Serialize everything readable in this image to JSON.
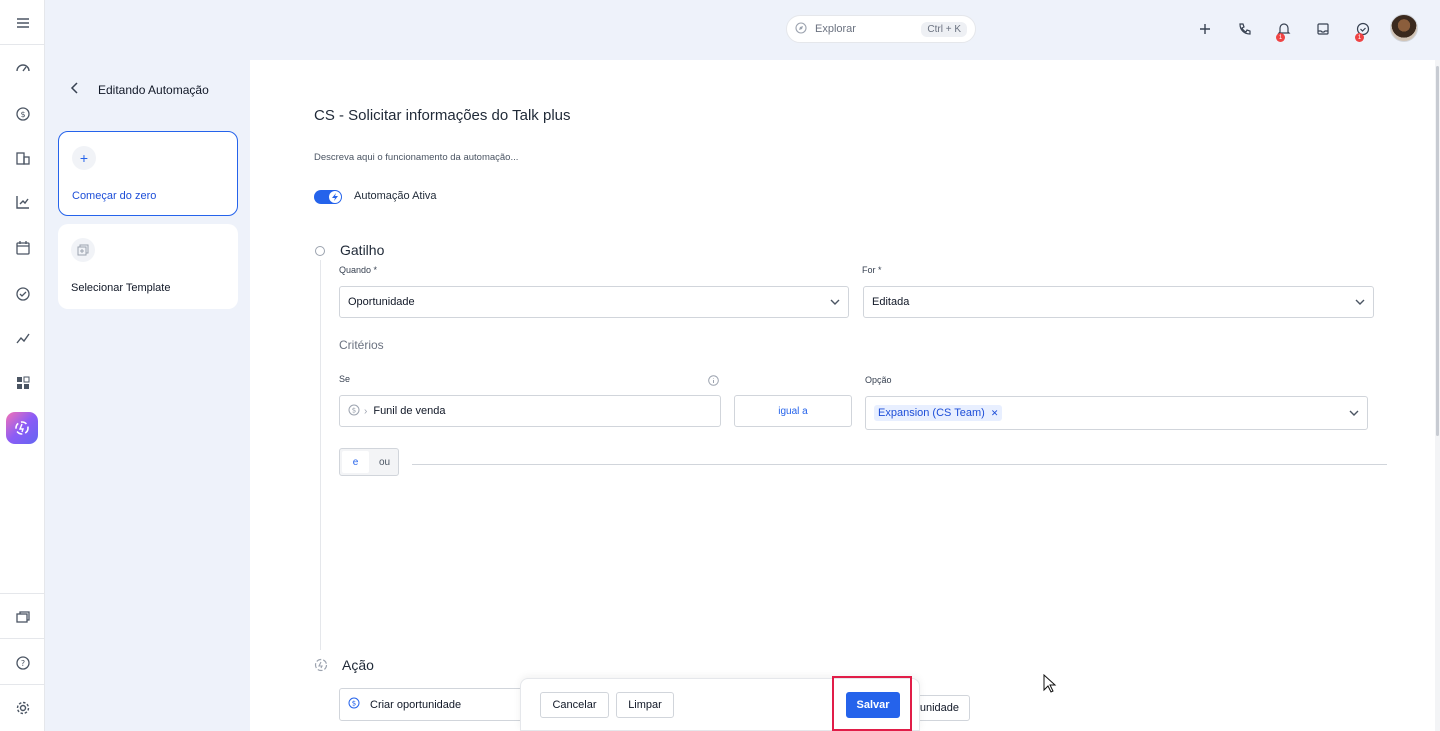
{
  "topbar": {
    "search_placeholder": "Explorar",
    "search_shortcut": "Ctrl + K",
    "notification_badges": [
      "1",
      "1"
    ]
  },
  "left_panel": {
    "header": "Editando Automação",
    "cards": [
      {
        "label": "Começar do zero",
        "icon": "plus-icon",
        "selected": true
      },
      {
        "label": "Selecionar Template",
        "icon": "template-icon",
        "selected": false
      }
    ]
  },
  "main": {
    "title": "CS - Solicitar informações do Talk plus",
    "description_placeholder": "Descreva aqui o funcionamento da automação...",
    "toggle_label": "Automação Ativa",
    "toggle_on": true,
    "trigger": {
      "section_title": "Gatilho",
      "when_label": "Quando *",
      "when_value": "Oportunidade",
      "for_label": "For *",
      "for_value": "Editada",
      "criteria_title": "Critérios",
      "if_label": "Se",
      "field_value": "Funil de venda",
      "operator": "igual a",
      "option_label": "Opção",
      "option_chip": "Expansion (CS Team)",
      "logic_and": "e",
      "logic_or": "ou"
    },
    "action": {
      "section_title": "Ação",
      "action_value": "Criar oportunidade",
      "partial_button": "unidade"
    }
  },
  "action_bar": {
    "cancel": "Cancelar",
    "clear": "Limpar",
    "save": "Salvar"
  },
  "colors": {
    "accent": "#2563eb",
    "highlight": "#e11d48",
    "page_bg": "#eef2fa"
  }
}
